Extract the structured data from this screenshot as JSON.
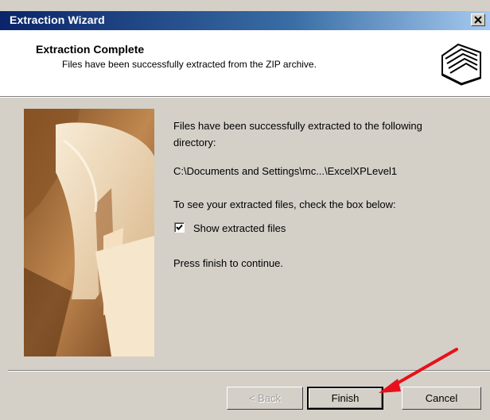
{
  "window": {
    "title": "Extraction Wizard"
  },
  "header": {
    "title": "Extraction Complete",
    "subtitle": "Files have been successfully extracted from the ZIP archive."
  },
  "content": {
    "line1": "Files have been successfully extracted to the following",
    "line2": "directory:",
    "directory": "C:\\Documents and Settings\\mc...\\ExcelXPLevel1",
    "line3": "To see your extracted files, check the box below:",
    "checkbox_label": "Show extracted files",
    "checkbox_checked": true,
    "line4": "Press finish to continue."
  },
  "buttons": {
    "back": "< Back",
    "finish": "Finish",
    "cancel": "Cancel"
  },
  "icons": {
    "close": "close-icon",
    "folder": "folder-icon",
    "check": "check-icon"
  },
  "colors": {
    "titlebar_start": "#0a246a",
    "annotation_arrow": "#e8101c"
  }
}
